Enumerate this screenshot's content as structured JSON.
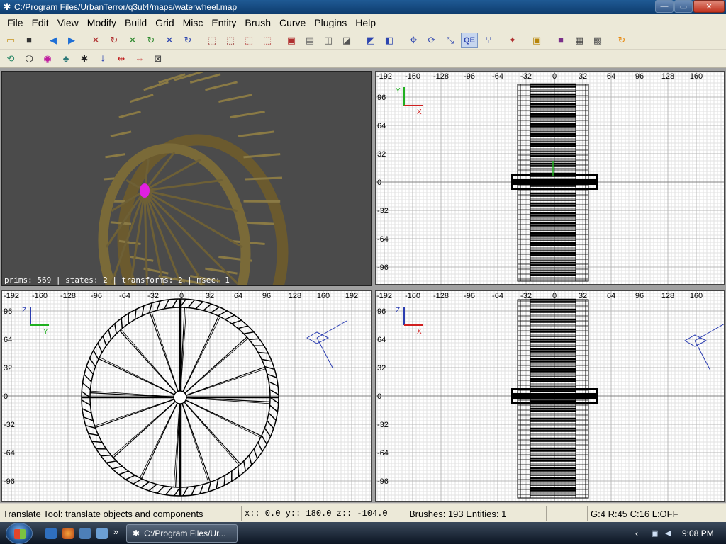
{
  "window": {
    "title": "C:/Program Files/UrbanTerror/q3ut4/maps/waterwheel.map",
    "minimize": "—",
    "maximize": "▭",
    "close": "✕"
  },
  "menu": [
    "File",
    "Edit",
    "View",
    "Modify",
    "Build",
    "Grid",
    "Misc",
    "Entity",
    "Brush",
    "Curve",
    "Plugins",
    "Help"
  ],
  "toolbar1": [
    {
      "name": "open-icon",
      "glyph": "▭",
      "color": "#c8941f"
    },
    {
      "name": "save-icon",
      "glyph": "■",
      "color": "#333333"
    },
    {
      "name": "undo-icon",
      "glyph": "◀",
      "color": "#1e6fd6"
    },
    {
      "name": "redo-icon",
      "glyph": "▶",
      "color": "#1e6fd6"
    },
    {
      "name": "flip-x-icon",
      "glyph": "✕",
      "color": "#b03030"
    },
    {
      "name": "rotate-x-icon",
      "glyph": "↻",
      "color": "#b03030"
    },
    {
      "name": "flip-y-icon",
      "glyph": "✕",
      "color": "#2f8a2f"
    },
    {
      "name": "rotate-y-icon",
      "glyph": "↻",
      "color": "#2f8a2f"
    },
    {
      "name": "flip-z-icon",
      "glyph": "✕",
      "color": "#2d45b0"
    },
    {
      "name": "rotate-z-icon",
      "glyph": "↻",
      "color": "#2d45b0"
    },
    {
      "name": "select-complete-tall-icon",
      "glyph": "⬚",
      "color": "#8a2020"
    },
    {
      "name": "select-touching-icon",
      "glyph": "⬚",
      "color": "#8a2020"
    },
    {
      "name": "select-partial-tall-icon",
      "glyph": "⬚",
      "color": "#b03030"
    },
    {
      "name": "select-inside-icon",
      "glyph": "⬚",
      "color": "#b03030"
    },
    {
      "name": "csg-subtract-icon",
      "glyph": "▣",
      "color": "#b03030"
    },
    {
      "name": "csg-merge-icon",
      "glyph": "▤",
      "color": "#666666"
    },
    {
      "name": "make-hollow-icon",
      "glyph": "◫",
      "color": "#555555"
    },
    {
      "name": "make-room-icon",
      "glyph": "◪",
      "color": "#555555"
    },
    {
      "name": "clipper-icon",
      "glyph": "◩",
      "color": "#2d45b0"
    },
    {
      "name": "change-views-icon",
      "glyph": "◧",
      "color": "#2d45b0"
    },
    {
      "name": "translate-icon",
      "glyph": "✥",
      "color": "#2d45b0"
    },
    {
      "name": "rotate-icon",
      "glyph": "⟳",
      "color": "#2d45b0"
    },
    {
      "name": "scale-icon",
      "glyph": "⤡",
      "color": "#2d45b0"
    },
    {
      "name": "qe-mode-icon",
      "glyph": "QE",
      "color": "#2d45b0",
      "active": true
    },
    {
      "name": "vertex-icon",
      "glyph": "⑂",
      "color": "#2d45b0"
    },
    {
      "name": "patch-texture-icon",
      "glyph": "✦",
      "color": "#b03030"
    },
    {
      "name": "lock-icon",
      "glyph": "▣",
      "color": "#b8860b"
    },
    {
      "name": "cube-icon",
      "glyph": "■",
      "color": "#7a2f8a"
    },
    {
      "name": "texture-icon",
      "glyph": "▦",
      "color": "#444444"
    },
    {
      "name": "texture-lock-icon",
      "glyph": "▩",
      "color": "#555555"
    },
    {
      "name": "refresh-icon",
      "glyph": "↻",
      "color": "#e88a10"
    }
  ],
  "toolbar2": [
    {
      "name": "bend-icon",
      "glyph": "⟲",
      "color": "#2f8a6a"
    },
    {
      "name": "hexagon-icon",
      "glyph": "⬡",
      "color": "#222222"
    },
    {
      "name": "model-icon",
      "glyph": "◉",
      "color": "#c020a0"
    },
    {
      "name": "tree-icon",
      "glyph": "♣",
      "color": "#2f7a7a"
    },
    {
      "name": "bug-icon",
      "glyph": "✱",
      "color": "#222222"
    },
    {
      "name": "drop-icon",
      "glyph": "⤓",
      "color": "#2d45b0"
    },
    {
      "name": "mirror-icon",
      "glyph": "⇹",
      "color": "#c02020"
    },
    {
      "name": "split-icon",
      "glyph": "⇔",
      "color": "#c02020"
    },
    {
      "name": "cancel-icon",
      "glyph": "⊠",
      "color": "#444444"
    }
  ],
  "camera": {
    "stats": "prims: 569 | states: 2 | transforms: 2 | msec: 1"
  },
  "views": {
    "top": {
      "axes": [
        "Y",
        "X"
      ],
      "xticks": [
        "-192",
        "-160",
        "-128",
        "-96",
        "-64",
        "-32",
        "0",
        "32",
        "64",
        "96",
        "128",
        "160"
      ],
      "yticks": [
        "96",
        "64",
        "32",
        "0",
        "-32",
        "-64",
        "-96"
      ]
    },
    "side": {
      "axes": [
        "Z",
        "Y"
      ],
      "xticks": [
        "-192",
        "-160",
        "-128",
        "-96",
        "-64",
        "-32",
        "0",
        "32",
        "64",
        "96",
        "128",
        "160",
        "192"
      ],
      "yticks": [
        "96",
        "64",
        "32",
        "0",
        "-32",
        "-64",
        "-96"
      ]
    },
    "front": {
      "axes": [
        "Z",
        "X"
      ],
      "xticks": [
        "-192",
        "-160",
        "-128",
        "-96",
        "-64",
        "-32",
        "0",
        "32",
        "64",
        "96",
        "128",
        "160"
      ],
      "yticks": [
        "96",
        "64",
        "32",
        "0",
        "-32",
        "-64",
        "-96"
      ]
    }
  },
  "status": {
    "message": "Translate Tool: translate objects and components",
    "coords": "x::    0.0  y::   180.0  z:: -104.0",
    "counts": "Brushes: 193 Entities: 1",
    "grid": "G:4  R:45  C:16  L:OFF"
  },
  "taskbar": {
    "task_label": "C:/Program Files/Ur...",
    "more": "»",
    "clock": "9:08 PM",
    "chevron": "‹"
  }
}
